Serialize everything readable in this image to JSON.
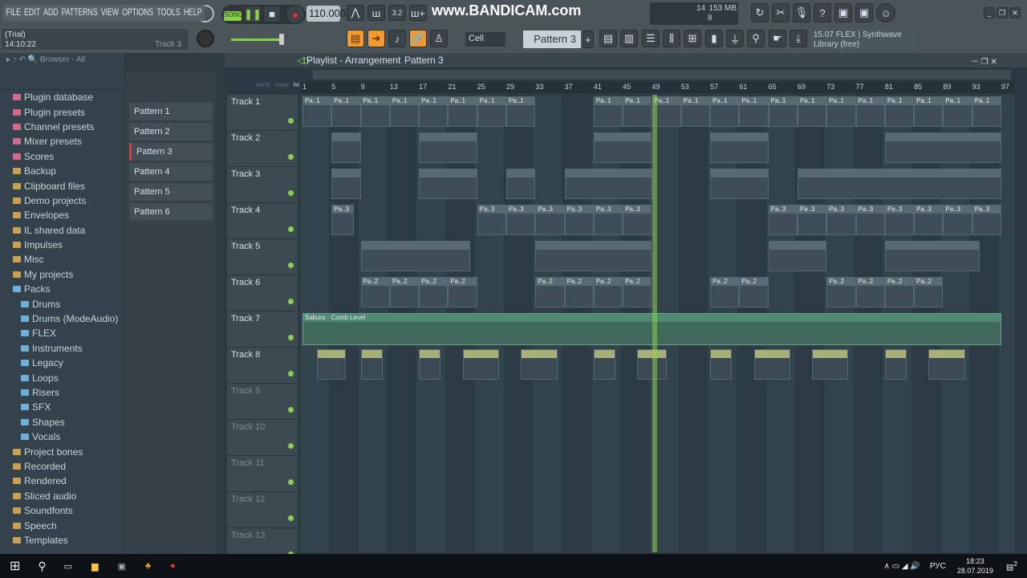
{
  "menu": [
    "FILE",
    "EDIT",
    "ADD",
    "PATTERNS",
    "VIEW",
    "OPTIONS",
    "TOOLS",
    "HELP"
  ],
  "hint": {
    "line1": "(Trial)",
    "line2": "14:10:22",
    "track": "Track 3"
  },
  "transport": {
    "mode": "SONG",
    "tempo": "110.000"
  },
  "watermark": "www.BANDICAM.com",
  "cpu": {
    "voices": "14",
    "memory": "153 MB",
    "polyphony": "8"
  },
  "snap": "Cell",
  "pattern_selector": "Pattern 3",
  "news": {
    "line1": "15.07  FLEX | Synthwave",
    "line2": "Library (free)"
  },
  "browser": {
    "title": "Browser - All",
    "items": [
      {
        "label": "Plugin database",
        "type": "pink"
      },
      {
        "label": "Plugin presets",
        "type": "pink"
      },
      {
        "label": "Channel presets",
        "type": "pink"
      },
      {
        "label": "Mixer presets",
        "type": "pink"
      },
      {
        "label": "Scores",
        "type": "pink"
      },
      {
        "label": "Backup",
        "type": "folder"
      },
      {
        "label": "Clipboard files",
        "type": "folder"
      },
      {
        "label": "Demo projects",
        "type": "folder"
      },
      {
        "label": "Envelopes",
        "type": "folder"
      },
      {
        "label": "IL shared data",
        "type": "folder"
      },
      {
        "label": "Impulses",
        "type": "folder"
      },
      {
        "label": "Misc",
        "type": "folder"
      },
      {
        "label": "My projects",
        "type": "folder"
      },
      {
        "label": "Packs",
        "type": "open"
      },
      {
        "label": "Drums",
        "type": "sub"
      },
      {
        "label": "Drums (ModeAudio)",
        "type": "sub"
      },
      {
        "label": "FLEX",
        "type": "sub"
      },
      {
        "label": "Instruments",
        "type": "sub"
      },
      {
        "label": "Legacy",
        "type": "sub"
      },
      {
        "label": "Loops",
        "type": "sub"
      },
      {
        "label": "Risers",
        "type": "sub"
      },
      {
        "label": "SFX",
        "type": "sub"
      },
      {
        "label": "Shapes",
        "type": "sub"
      },
      {
        "label": "Vocals",
        "type": "sub"
      },
      {
        "label": "Project bones",
        "type": "folder"
      },
      {
        "label": "Recorded",
        "type": "folder"
      },
      {
        "label": "Rendered",
        "type": "folder"
      },
      {
        "label": "Sliced audio",
        "type": "folder"
      },
      {
        "label": "Soundfonts",
        "type": "folder"
      },
      {
        "label": "Speech",
        "type": "folder"
      },
      {
        "label": "Templates",
        "type": "folder"
      }
    ]
  },
  "patterns": [
    "Pattern 1",
    "Pattern 2",
    "Pattern 3",
    "Pattern 4",
    "Pattern 5",
    "Pattern 6"
  ],
  "playlist": {
    "title": "Playlist - Arrangement",
    "pattern": "Pattern 3",
    "ruler_labels": [
      "NOTE",
      "CHAN",
      "PAT"
    ],
    "bars": [
      "1",
      "5",
      "9",
      "13",
      "17",
      "21",
      "25",
      "29",
      "33",
      "37",
      "41",
      "45",
      "49",
      "53",
      "57",
      "61",
      "65",
      "69",
      "73",
      "77",
      "81",
      "85",
      "89",
      "93",
      "97"
    ],
    "playhead_bar": 49,
    "tracks": [
      {
        "name": "Track 1",
        "label": "Pa..1",
        "clips": [
          [
            1,
            4
          ],
          [
            5,
            4
          ],
          [
            9,
            4
          ],
          [
            13,
            4
          ],
          [
            17,
            4
          ],
          [
            21,
            4
          ],
          [
            25,
            4
          ],
          [
            29,
            4
          ],
          [
            41,
            4
          ],
          [
            45,
            4
          ],
          [
            49,
            4
          ],
          [
            53,
            4
          ],
          [
            57,
            4
          ],
          [
            61,
            4
          ],
          [
            65,
            4
          ],
          [
            69,
            4
          ],
          [
            73,
            4
          ],
          [
            77,
            4
          ],
          [
            81,
            4
          ],
          [
            85,
            4
          ],
          [
            89,
            4
          ],
          [
            93,
            4
          ]
        ]
      },
      {
        "name": "Track 2",
        "label": "",
        "clips": [
          [
            5,
            4
          ],
          [
            17,
            8
          ],
          [
            41,
            8
          ],
          [
            57,
            8
          ],
          [
            81,
            16
          ]
        ]
      },
      {
        "name": "Track 3",
        "label": "",
        "clips": [
          [
            5,
            4
          ],
          [
            17,
            8
          ],
          [
            29,
            4
          ],
          [
            37,
            12
          ],
          [
            57,
            8
          ],
          [
            69,
            28
          ]
        ]
      },
      {
        "name": "Track 4",
        "label": "Pa..3",
        "clips": [
          [
            5,
            3
          ],
          [
            25,
            4
          ],
          [
            29,
            4
          ],
          [
            33,
            4
          ],
          [
            37,
            4
          ],
          [
            41,
            4
          ],
          [
            45,
            4
          ],
          [
            65,
            4
          ],
          [
            69,
            4
          ],
          [
            73,
            4
          ],
          [
            77,
            4
          ],
          [
            81,
            4
          ],
          [
            85,
            4
          ],
          [
            89,
            4
          ],
          [
            93,
            4
          ]
        ]
      },
      {
        "name": "Track 5",
        "label": "",
        "clips": [
          [
            9,
            15
          ],
          [
            33,
            16
          ],
          [
            65,
            8
          ],
          [
            81,
            13
          ]
        ]
      },
      {
        "name": "Track 6",
        "label": "Pa..2",
        "clips": [
          [
            9,
            4
          ],
          [
            13,
            4
          ],
          [
            17,
            4
          ],
          [
            21,
            4
          ],
          [
            33,
            4
          ],
          [
            37,
            4
          ],
          [
            41,
            4
          ],
          [
            45,
            4
          ],
          [
            57,
            4
          ],
          [
            61,
            4
          ],
          [
            73,
            4
          ],
          [
            77,
            4
          ],
          [
            81,
            4
          ],
          [
            85,
            4
          ]
        ]
      },
      {
        "name": "Track 7",
        "label": "Sakura - Comb Level",
        "automation": true,
        "clips": [
          [
            1,
            96
          ]
        ]
      },
      {
        "name": "Track 8",
        "label": "",
        "audio": true,
        "clips": [
          [
            3,
            4
          ],
          [
            9,
            3
          ],
          [
            17,
            3
          ],
          [
            23,
            5
          ],
          [
            31,
            5
          ],
          [
            41,
            3
          ],
          [
            47,
            4
          ],
          [
            57,
            3
          ],
          [
            63,
            5
          ],
          [
            71,
            5
          ],
          [
            81,
            3
          ],
          [
            87,
            5
          ]
        ]
      },
      {
        "name": "Track 9",
        "clips": []
      },
      {
        "name": "Track 10",
        "clips": []
      },
      {
        "name": "Track 11",
        "clips": []
      },
      {
        "name": "Track 12",
        "clips": []
      },
      {
        "name": "Track 13",
        "clips": []
      }
    ]
  },
  "taskbar": {
    "lang": "РУС",
    "time": "18:23",
    "date": "28.07.2019",
    "notifications": "2"
  },
  "colors": {
    "accent": "#f09a30",
    "playhead": "#8bd04a"
  }
}
